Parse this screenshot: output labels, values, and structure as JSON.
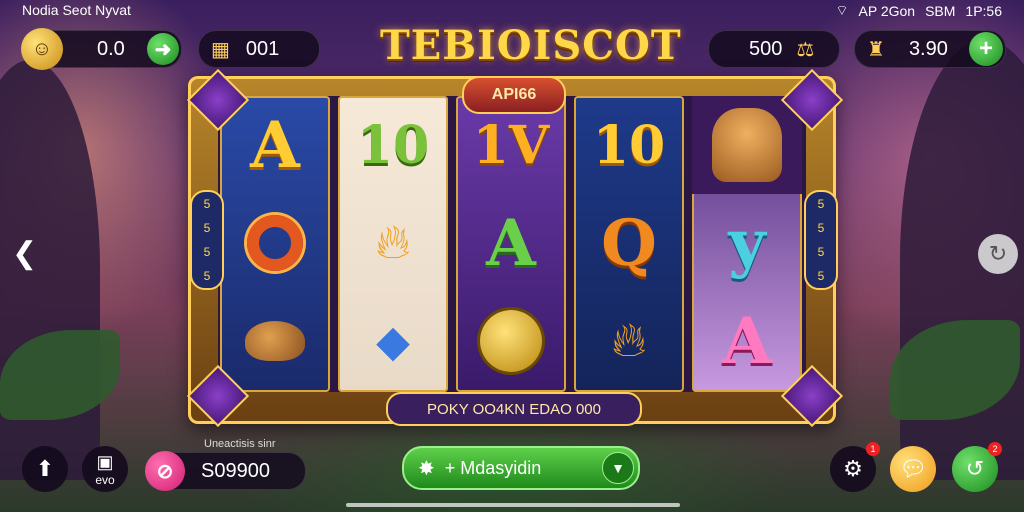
{
  "status_bar": {
    "title": "Nodia Seot Nyvat",
    "wifi_icon": "wifi-icon",
    "info": "AP 2Gon",
    "battery": "SBM",
    "time": "1P:56"
  },
  "top_bar": {
    "left_balance": "0.0",
    "gems": "001",
    "game_title": "TEBIOISCOT",
    "right_coins": "500",
    "right_balance": "3.90"
  },
  "reels": {
    "badge": "API66",
    "side_left": [
      "5",
      "5",
      "5",
      "5"
    ],
    "side_right": [
      "5",
      "5",
      "5",
      "5"
    ],
    "columns": [
      [
        "A",
        "ring",
        "nut"
      ],
      [
        "10",
        "flame",
        "gems"
      ],
      [
        "1V",
        "A",
        "coin"
      ],
      [
        "10",
        "Q",
        "flame"
      ],
      [
        "lion",
        "y",
        "A"
      ]
    ],
    "info_text": "POKY OO4KN EDAO 000"
  },
  "bottom_bar": {
    "balance_label": "Uneactisis sinr",
    "balance_value": "S09900",
    "menu_label": "evo",
    "spin_label": "+ Mdasyidin",
    "settings_badge": "1",
    "refresh_badge": "2"
  },
  "colors": {
    "gold": "#ffd84a",
    "green": "#2fae2a",
    "pink": "#e8307f",
    "purple": "#4a2a7a"
  }
}
